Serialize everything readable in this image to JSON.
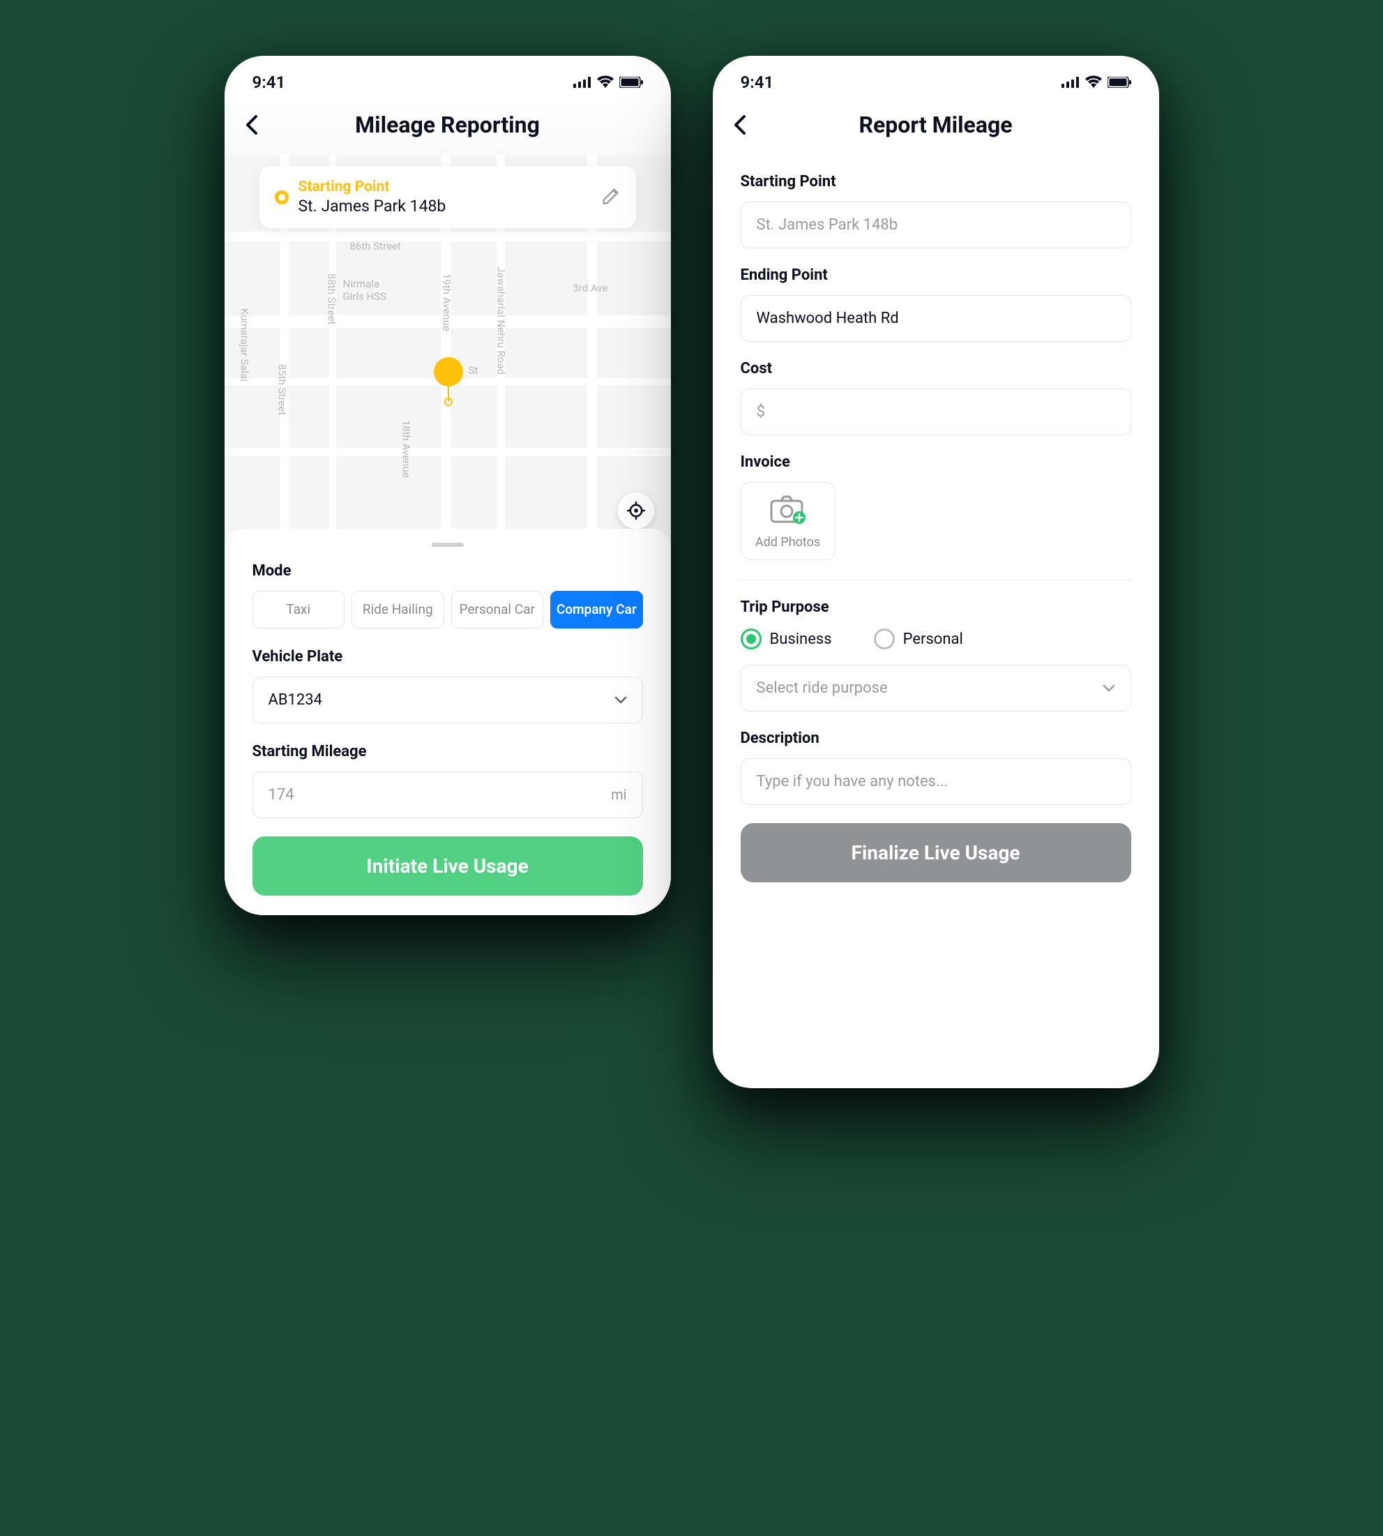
{
  "status": {
    "time": "9:41"
  },
  "screen1": {
    "title": "Mileage Reporting",
    "start": {
      "label": "Starting Point",
      "address": "St. James Park 148b"
    },
    "map_labels": {
      "st86": "86th Street",
      "nirmala": "Nirmala\nGirls HSS",
      "third": "3rd Ave",
      "av19": "19th Avenue",
      "st88": "88th Street",
      "nehru": "Jawaharlal Nehru Road",
      "av18": "18th Avenue",
      "kumar": "Kumarajar Salai",
      "st85": "85th Street",
      "st": "St"
    },
    "mode": {
      "label": "Mode",
      "options": [
        "Taxi",
        "Ride Hailing",
        "Personal Car",
        "Company Car"
      ],
      "selected": 3
    },
    "plate": {
      "label": "Vehicle Plate",
      "value": "AB1234"
    },
    "mileage": {
      "label": "Starting Mileage",
      "value": "174",
      "unit": "mi"
    },
    "cta": "Initiate Live Usage"
  },
  "screen2": {
    "title": "Report Mileage",
    "start": {
      "label": "Starting Point",
      "placeholder": "St. James Park 148b"
    },
    "end": {
      "label": "Ending Point",
      "value": "Washwood Heath Rd"
    },
    "cost": {
      "label": "Cost",
      "prefix": "$"
    },
    "invoice": {
      "label": "Invoice",
      "add_photos": "Add Photos"
    },
    "purpose": {
      "label": "Trip Purpose",
      "options": [
        "Business",
        "Personal"
      ],
      "selected": 0,
      "select_placeholder": "Select ride purpose"
    },
    "description": {
      "label": "Description",
      "placeholder": "Type if you have any notes..."
    },
    "cta": "Finalize Live Usage"
  }
}
